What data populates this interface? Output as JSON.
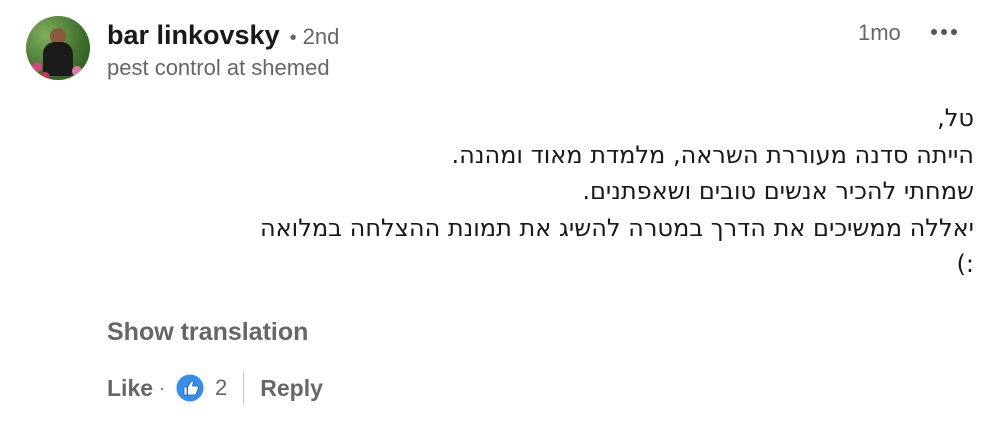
{
  "author": {
    "name": "bar linkovsky",
    "degree": "2nd",
    "separator": "•",
    "headline": "pest control at shemed"
  },
  "meta": {
    "time": "1mo",
    "more_icon": "ellipsis-icon"
  },
  "comment": {
    "lines": [
      "טל,",
      "הייתה סדנה מעוררת השראה, מלמדת מאוד ומהנה.",
      "שמחתי להכיר אנשים טובים ושאפתנים.",
      "יאללה ממשיכים את הדרך במטרה להשיג את תמונת ההצלחה במלואה",
      ":)"
    ]
  },
  "show_translation_label": "Show translation",
  "actions": {
    "like_label": "Like",
    "separator": "·",
    "like_count": "2",
    "reply_label": "Reply",
    "like_icon": "thumbs-up-icon",
    "accent_color": "#378fe9"
  }
}
